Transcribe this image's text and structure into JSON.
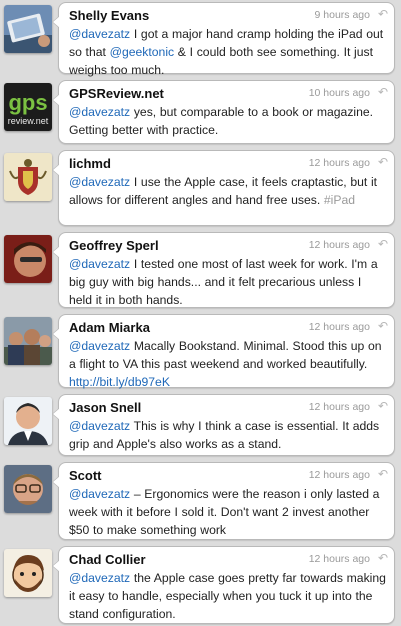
{
  "icons": {
    "reply": "reply-arrow-icon"
  },
  "colors": {
    "link": "#1f68b8",
    "time": "#9a9a9a",
    "background": "#dcdcdc"
  },
  "tweets": [
    {
      "name": "Shelly Evans",
      "time": "9 hours ago",
      "avatar": "ipad-photo",
      "parts": [
        {
          "t": "@davezatz",
          "k": "mention"
        },
        {
          "t": " I got a major hand cramp holding the iPad out so that "
        },
        {
          "t": "@geektonic",
          "k": "mention"
        },
        {
          "t": " & I could both see something. It just weighs too much."
        }
      ]
    },
    {
      "name": "GPSReview.net",
      "time": "10 hours ago",
      "avatar": "gps-logo",
      "avatar_text": "gps",
      "avatar_subtext": "review.net",
      "parts": [
        {
          "t": "@davezatz",
          "k": "mention"
        },
        {
          "t": " yes, but comparable to a book or magazine. Getting better with practice."
        }
      ]
    },
    {
      "name": "lichmd",
      "time": "12 hours ago",
      "avatar": "heraldic-crest",
      "parts": [
        {
          "t": "@davezatz",
          "k": "mention"
        },
        {
          "t": " I use the Apple case, it feels craptastic, but it allows for different angles and hand free uses. "
        },
        {
          "t": "#iPad",
          "k": "hashtag"
        }
      ]
    },
    {
      "name": "Geoffrey Sperl",
      "time": "12 hours ago",
      "avatar": "person-red",
      "parts": [
        {
          "t": "@davezatz",
          "k": "mention"
        },
        {
          "t": " I tested one most of last week for work. I'm a big guy with big hands... and it felt precarious unless I held it in both hands."
        }
      ]
    },
    {
      "name": "Adam Miarka",
      "time": "12 hours ago",
      "avatar": "group-photo",
      "parts": [
        {
          "t": "@davezatz",
          "k": "mention"
        },
        {
          "t": " Macally Bookstand.   Minimal.   Stood this up on a flight to VA this past weekend and worked beautifully.   "
        },
        {
          "t": "http://bit.ly/db97eK",
          "k": "link"
        }
      ]
    },
    {
      "name": "Jason Snell",
      "time": "12 hours ago",
      "avatar": "person-suit",
      "parts": [
        {
          "t": "@davezatz",
          "k": "mention"
        },
        {
          "t": " This is why I think a case is essential. It adds grip and Apple's also works as a stand."
        }
      ]
    },
    {
      "name": "Scott",
      "time": "12 hours ago",
      "avatar": "person-glasses",
      "parts": [
        {
          "t": "@davezatz",
          "k": "mention"
        },
        {
          "t": " – Ergonomics were the reason i only lasted a week with it before I sold it. Don't want 2 invest another $50 to make something work"
        }
      ]
    },
    {
      "name": "Chad Collier",
      "time": "12 hours ago",
      "avatar": "cartoon-face",
      "parts": [
        {
          "t": "@davezatz",
          "k": "mention"
        },
        {
          "t": " the Apple case goes pretty far towards making it easy to handle, especially when you tuck it up into the stand configuration."
        }
      ]
    }
  ]
}
